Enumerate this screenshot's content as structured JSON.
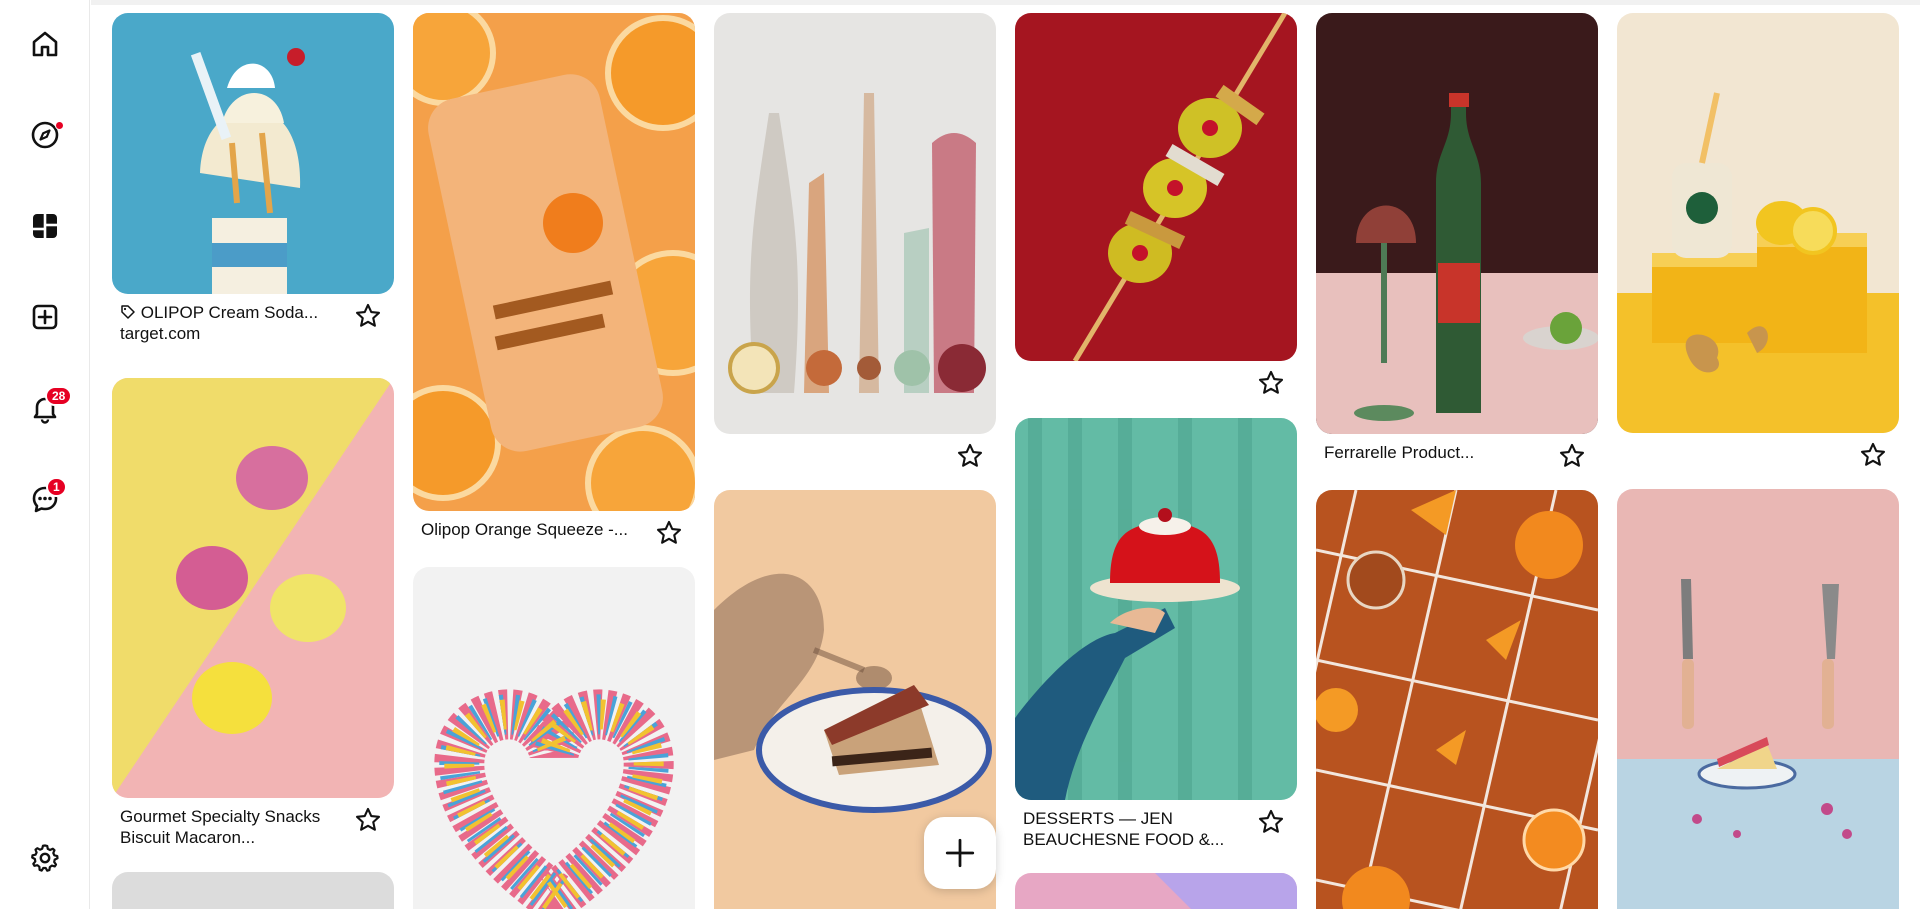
{
  "sidebar": {
    "items": [
      {
        "name": "home",
        "icon": "home-icon"
      },
      {
        "name": "explore",
        "icon": "compass-icon",
        "has_dot": true
      },
      {
        "name": "boards",
        "icon": "boards-icon"
      },
      {
        "name": "create",
        "icon": "plus-square-icon"
      },
      {
        "name": "notifications",
        "icon": "bell-icon",
        "badge": "28"
      },
      {
        "name": "messages",
        "icon": "chat-icon",
        "badge": "1"
      }
    ],
    "settings_icon": "gear-icon",
    "accent": "#e60023"
  },
  "pins": {
    "olipop_cream_soda": {
      "title": "OLIPOP Cream Soda...",
      "source": "target.com",
      "tag_icon": "tag-icon"
    },
    "olipop_orange": {
      "title": "Olipop Orange Squeeze -..."
    },
    "bottles_shadows": {
      "title": ""
    },
    "olive_rings": {
      "title": ""
    },
    "ferrarelle": {
      "title": "Ferrarelle Product..."
    },
    "ginger_lemon": {
      "title": ""
    },
    "macarons": {
      "title": "Gourmet Specialty Snacks Biscuit Macaron..."
    },
    "sprinkles_heart": {
      "title": ""
    },
    "cake_shadow": {
      "title": ""
    },
    "desserts_jello": {
      "title": "DESSERTS — JEN BEAUCHESNE FOOD &..."
    },
    "orange_tiles": {
      "title": ""
    },
    "knife_fork_cake": {
      "title": ""
    }
  },
  "floating_button": {
    "icon": "plus-icon"
  }
}
